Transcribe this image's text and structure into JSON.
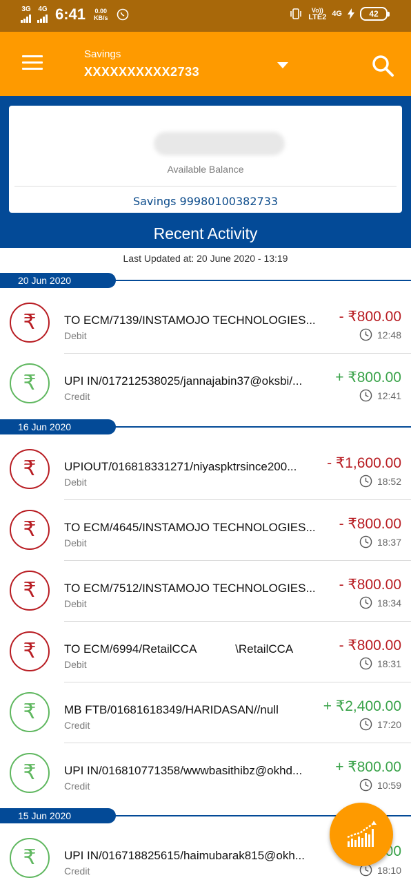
{
  "status_bar": {
    "sim1_label": "3G",
    "sim2_label": "4G",
    "time": "6:41",
    "data_speed_value": "0.00",
    "data_speed_unit": "KB/s",
    "volte_label_top": "Vo))",
    "volte_label_bottom": "LTE2",
    "network_label": "4G",
    "battery": "42"
  },
  "header": {
    "account_type": "Savings",
    "account_number_masked": "XXXXXXXXXX2733",
    "background_color": "#fe9a00"
  },
  "balance_card": {
    "label": "Available Balance",
    "account_line": "Savings 99980100382733"
  },
  "recent_activity": {
    "title": "Recent Activity",
    "last_updated": "Last Updated at: 20 June 2020 - 13:19"
  },
  "groups": [
    {
      "date": "20 Jun 2020",
      "transactions": [
        {
          "kind": "debit",
          "description": "TO ECM/7139/INSTAMOJO TECHNOLOGIES...",
          "type": "Debit",
          "amount": "- ₹800.00",
          "time": "12:48"
        },
        {
          "kind": "credit",
          "description": "UPI IN/017212538025/jannajabin37@oksbi/...",
          "type": "Credit",
          "amount": "+ ₹800.00",
          "time": "12:41"
        }
      ]
    },
    {
      "date": "16 Jun 2020",
      "transactions": [
        {
          "kind": "debit",
          "description": "UPIOUT/016818331271/niyaspktrsince200...",
          "type": "Debit",
          "amount": "- ₹1,600.00",
          "time": "18:52"
        },
        {
          "kind": "debit",
          "description": "TO ECM/4645/INSTAMOJO TECHNOLOGIES...",
          "type": "Debit",
          "amount": "- ₹800.00",
          "time": "18:37"
        },
        {
          "kind": "debit",
          "description": "TO ECM/7512/INSTAMOJO TECHNOLOGIES...",
          "type": "Debit",
          "amount": "- ₹800.00",
          "time": "18:34"
        },
        {
          "kind": "debit",
          "description": "TO ECM/6994/RetailCCA            \\RetailCCA",
          "type": "Debit",
          "amount": "- ₹800.00",
          "time": "18:31"
        },
        {
          "kind": "credit",
          "description": "MB FTB/01681618349/HARIDASAN//null",
          "type": "Credit",
          "amount": "+ ₹2,400.00",
          "time": "17:20"
        },
        {
          "kind": "credit",
          "description": "UPI IN/016810771358/wwwbasithibz@okhd...",
          "type": "Credit",
          "amount": "+ ₹800.00",
          "time": "10:59"
        }
      ]
    },
    {
      "date": "15 Jun 2020",
      "transactions": [
        {
          "kind": "credit",
          "description": "UPI IN/016718825615/haimubarak815@okh...",
          "type": "Credit",
          "amount": "00",
          "time": "18:10"
        }
      ]
    }
  ],
  "icons": {
    "menu": "hamburger-menu-icon",
    "search": "search-icon",
    "dropdown": "caret-down-icon",
    "transaction": "rupee-icon",
    "time": "clock-icon",
    "fab": "analytics-chart-icon"
  },
  "colors": {
    "status_bar": "#a8680a",
    "primary_blue": "#034a97",
    "debit": "#b81c22",
    "credit": "#3aa34a"
  }
}
